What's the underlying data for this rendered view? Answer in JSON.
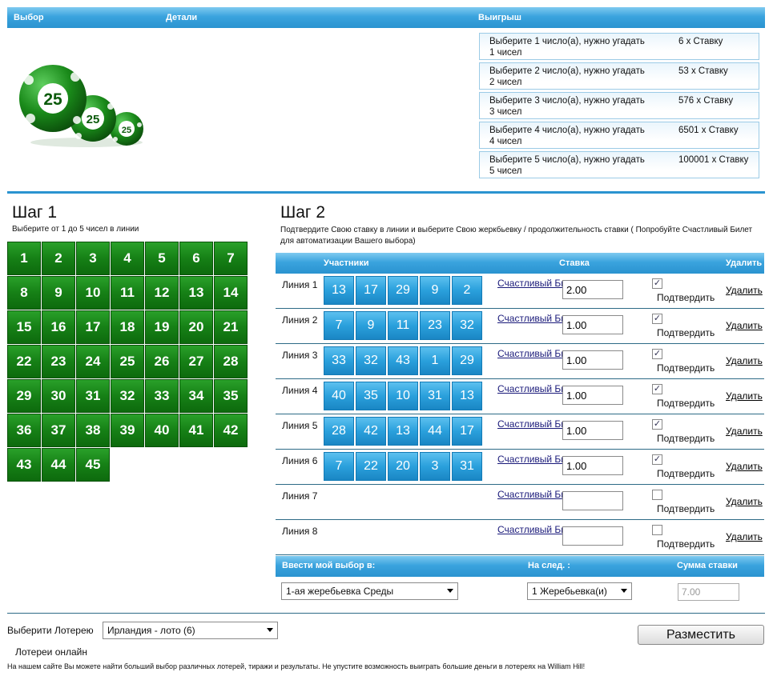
{
  "header": {
    "col_choice": "Выбор",
    "col_details": "Детали",
    "col_prize": "Выигрыш"
  },
  "payouts": [
    {
      "desc": "Выберите 1 число(а), нужно угадать 1 чисел",
      "value": "6 x Ставку"
    },
    {
      "desc": "Выберите 2 число(а), нужно угадать 2 чисел",
      "value": "53 x Ставку"
    },
    {
      "desc": "Выберите 3 число(а), нужно угадать 3 чисел",
      "value": "576 x Ставку"
    },
    {
      "desc": "Выберите 4 число(а), нужно угадать 4 чисел",
      "value": "6501 x Ставку"
    },
    {
      "desc": "Выберите 5 число(а), нужно угадать 5 чисел",
      "value": "100001 x Ставку"
    }
  ],
  "balls": {
    "label": "25",
    "icon": "lottery-balls-icon"
  },
  "step1": {
    "title": "Шаг 1",
    "subtitle": "Выберите от 1 до 5 чисел в линии",
    "numbers": [
      "1",
      "2",
      "3",
      "4",
      "5",
      "6",
      "7",
      "8",
      "9",
      "10",
      "11",
      "12",
      "13",
      "14",
      "15",
      "16",
      "17",
      "18",
      "19",
      "20",
      "21",
      "22",
      "23",
      "24",
      "25",
      "26",
      "27",
      "28",
      "29",
      "30",
      "31",
      "32",
      "33",
      "34",
      "35",
      "36",
      "37",
      "38",
      "39",
      "40",
      "41",
      "42",
      "43",
      "44",
      "45"
    ]
  },
  "step2": {
    "title": "Шаг 2",
    "subtitle": "Подтвердите Свою ставку в линии и выберите Свою жеркбьевку / продолжительность ставки ( Попробуйте Счастливый Билет для автоматизации Вашего выбора)",
    "col_participants": "Участники",
    "col_stake": "Ставка",
    "col_delete": "Удалить",
    "lucky_label": "Счастливый Билет",
    "confirm_label": "Подтвердить",
    "delete_label": "Удалить",
    "lines": [
      {
        "label": "Линия 1",
        "picks": [
          "13",
          "17",
          "29",
          "9",
          "2"
        ],
        "stake": "2.00",
        "confirmed": true
      },
      {
        "label": "Линия 2",
        "picks": [
          "7",
          "9",
          "11",
          "23",
          "32"
        ],
        "stake": "1.00",
        "confirmed": true
      },
      {
        "label": "Линия 3",
        "picks": [
          "33",
          "32",
          "43",
          "1",
          "29"
        ],
        "stake": "1.00",
        "confirmed": true
      },
      {
        "label": "Линия 4",
        "picks": [
          "40",
          "35",
          "10",
          "31",
          "13"
        ],
        "stake": "1.00",
        "confirmed": true
      },
      {
        "label": "Линия 5",
        "picks": [
          "28",
          "42",
          "13",
          "44",
          "17"
        ],
        "stake": "1.00",
        "confirmed": true
      },
      {
        "label": "Линия 6",
        "picks": [
          "7",
          "22",
          "20",
          "3",
          "31"
        ],
        "stake": "1.00",
        "confirmed": true
      },
      {
        "label": "Линия 7",
        "picks": [],
        "stake": "",
        "confirmed": false
      },
      {
        "label": "Линия 8",
        "picks": [],
        "stake": "",
        "confirmed": false
      }
    ]
  },
  "draws": {
    "col_enter": "Ввести мой выбор в:",
    "col_next": "На след. :",
    "col_total": "Сумма ставки",
    "draw_select": "1-ая жеребьевка Среды",
    "next_select": "1 Жеребьевка(и)",
    "total": "7.00"
  },
  "footer": {
    "lottery_label": "Выберити Лотерею",
    "lottery_select": "Ирландия - лото (6)",
    "place_button": "Разместить",
    "online_title": "Лотереи онлайн",
    "text": "На нашем сайте Вы можете найти больший выбор различных лотерей, тиражи и результаты. Не упустите возможность выиграть большие деньги в лотереях на William Hill!"
  }
}
